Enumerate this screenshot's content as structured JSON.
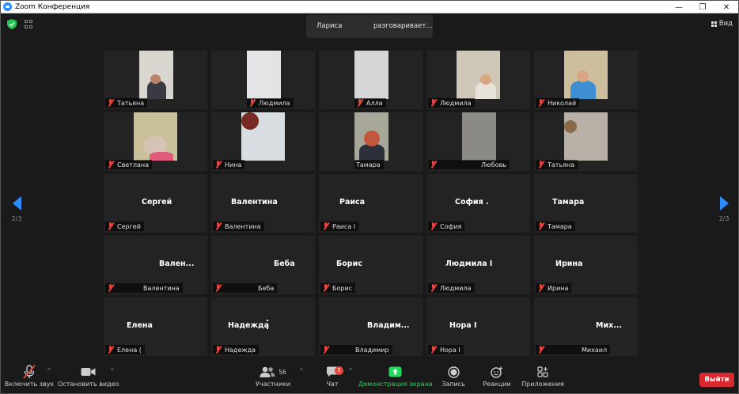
{
  "window": {
    "title": "Zoom Конференция",
    "minimize_glyph": "—",
    "restore_glyph": "❐",
    "close_glyph": "✕"
  },
  "topbar": {
    "speaker_name": "Лариса",
    "speaker_status": "разговаривает...",
    "view_label": "Вид"
  },
  "navigation": {
    "left_page": "2/3",
    "right_page": "2/3"
  },
  "tiles": [
    {
      "name": "Татьяна",
      "video": true
    },
    {
      "name": "Людмила",
      "video": true
    },
    {
      "name": "Алла",
      "video": true
    },
    {
      "name": "Людмила",
      "video": true
    },
    {
      "name": "Николай",
      "video": true
    },
    {
      "name": "Светлана",
      "video": true
    },
    {
      "name": "Нина",
      "video": true
    },
    {
      "name": "Тамара",
      "video": true
    },
    {
      "name": "Любовь",
      "video": true
    },
    {
      "name": "Татьяна",
      "video": true
    },
    {
      "name": "Сергей",
      "display": "Сергей",
      "video": false
    },
    {
      "name": "Валентина",
      "display": "Валентина",
      "video": false
    },
    {
      "name": "Раиса I",
      "display": "Раиса",
      "video": false
    },
    {
      "name": "София",
      "display": "София .",
      "video": false
    },
    {
      "name": "Тамара",
      "display": "Тамара",
      "video": false
    },
    {
      "name": "Валентина",
      "display": "Вален...",
      "video": false
    },
    {
      "name": "Беба",
      "display": "Беба",
      "video": false
    },
    {
      "name": "Борис",
      "display": "Борис",
      "video": false
    },
    {
      "name": "Людмила",
      "display": "Людмила I",
      "video": false
    },
    {
      "name": "Ирина",
      "display": "Ирина",
      "video": false
    },
    {
      "name": "Елена (",
      "display": "Елена",
      "video": false
    },
    {
      "name": "Надежда",
      "display": "Надежда",
      "video": false
    },
    {
      "name": "Владимир",
      "display": "Владим...",
      "video": false
    },
    {
      "name": "Нора I",
      "display": "Нора I",
      "video": false
    },
    {
      "name": "Михаил",
      "display": "Мих...",
      "video": false
    }
  ],
  "toolbar": {
    "unmute_label": "Включить звук",
    "stop_video_label": "Остановить видео",
    "participants_label": "Участники",
    "participants_count": "56",
    "chat_label": "Чат",
    "chat_badge": "5",
    "share_label": "Демонстрация экрана",
    "record_label": "Запись",
    "reactions_label": "Реакции",
    "apps_label": "Приложения",
    "leave_label": "Выйти"
  },
  "colors": {
    "accent": "#2d8cff",
    "share_green": "#23d959",
    "leave_red": "#d9282f",
    "muted_red": "#e8453c"
  }
}
